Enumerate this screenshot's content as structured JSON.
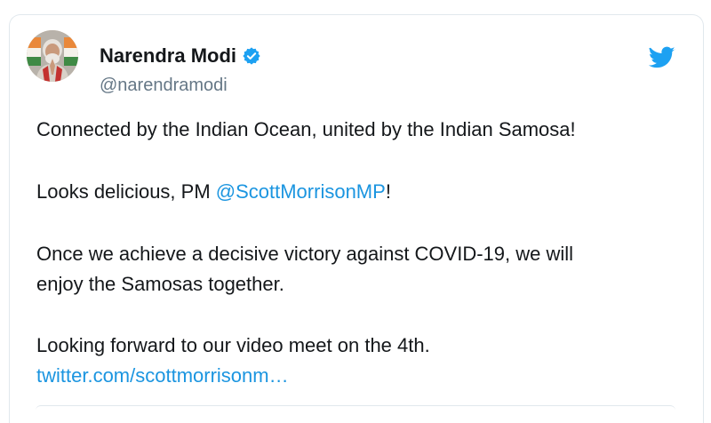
{
  "author": {
    "name": "Narendra Modi",
    "handle": "@narendramodi",
    "verified": true
  },
  "tweet": {
    "line1": "Connected by the Indian Ocean, united by the Indian Samosa!",
    "line2_prefix": "Looks delicious, PM ",
    "line2_mention": "@ScottMorrisonMP",
    "line2_suffix": "!",
    "line3a": "Once we achieve a decisive victory against COVID-19, we will",
    "line3b": "enjoy the Samosas together.",
    "line4": "Looking forward to our video meet on the 4th.",
    "link": "twitter.com/scottmorrisonm…"
  },
  "colors": {
    "link": "#1b95e0",
    "verified": "#1da1f2",
    "twitter_brand": "#1da1f2",
    "handle": "#657786"
  },
  "icons": {
    "verified": "verified-badge-icon",
    "brand": "twitter-bird-icon"
  }
}
